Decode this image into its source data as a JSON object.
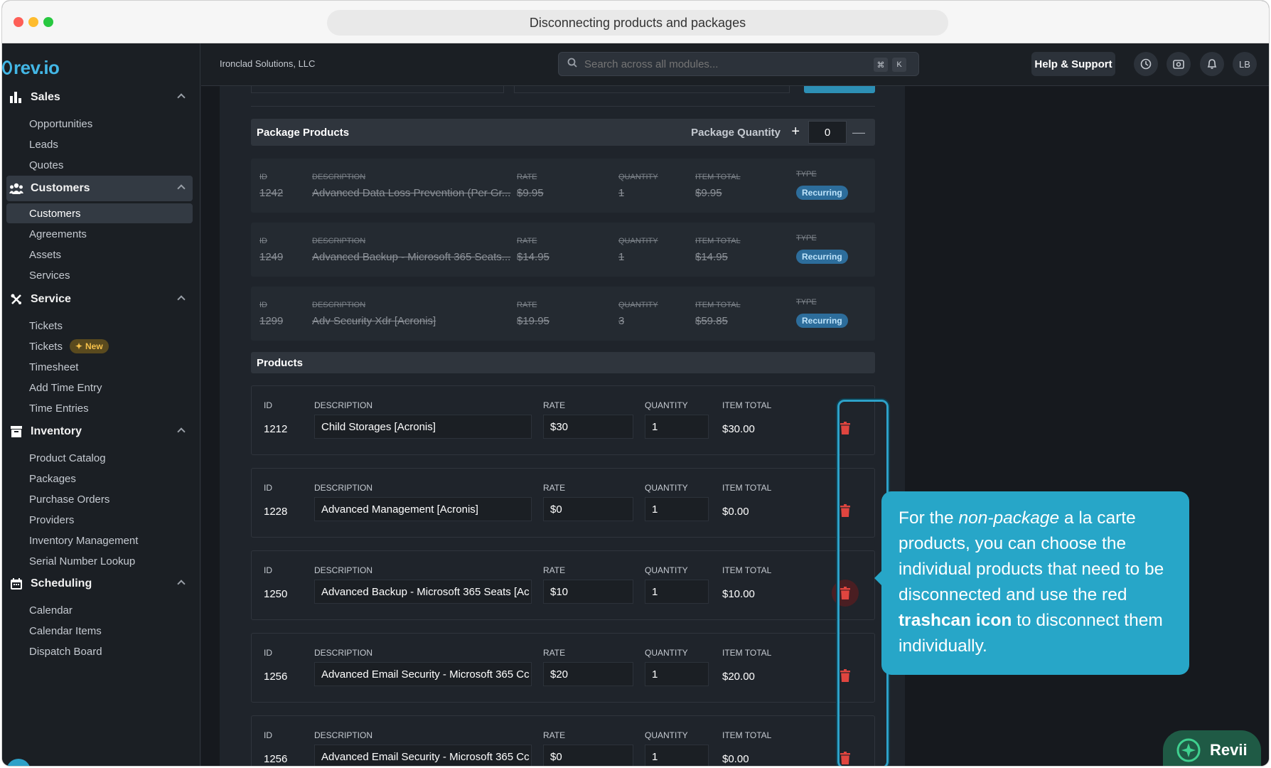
{
  "window": {
    "title": "Disconnecting products and packages"
  },
  "app": {
    "logo": "rev.io",
    "company": "Ironclad Solutions, LLC"
  },
  "search": {
    "placeholder": "Search across all modules...",
    "kbd1": "⌘",
    "kbd2": "K"
  },
  "header": {
    "help": "Help & Support",
    "avatar": "LB"
  },
  "sidebar": {
    "sections": [
      {
        "label": "Sales",
        "icon": "bar-chart-icon",
        "items": [
          "Opportunities",
          "Leads",
          "Quotes"
        ]
      },
      {
        "label": "Customers",
        "icon": "users-icon",
        "items": [
          "Customers",
          "Agreements",
          "Assets",
          "Services"
        ]
      },
      {
        "label": "Service",
        "icon": "tools-icon",
        "items": [
          "Tickets",
          "Tickets",
          "Timesheet",
          "Add Time Entry",
          "Time Entries"
        ]
      },
      {
        "label": "Inventory",
        "icon": "box-icon",
        "items": [
          "Product Catalog",
          "Packages",
          "Purchase Orders",
          "Providers",
          "Inventory Management",
          "Serial Number Lookup"
        ]
      },
      {
        "label": "Scheduling",
        "icon": "calendar-icon",
        "items": [
          "Calendar",
          "Calendar Items",
          "Dispatch Board"
        ]
      }
    ],
    "new_badge": "New"
  },
  "package_products": {
    "title": "Package Products",
    "quantity_label": "Package Quantity",
    "quantity": "0",
    "columns": [
      "ID",
      "DESCRIPTION",
      "RATE",
      "QUANTITY",
      "ITEM TOTAL",
      "TYPE"
    ],
    "rows": [
      {
        "id": "1242",
        "description": "Advanced Data Loss Prevention (Per Gr...",
        "rate": "$9.95",
        "quantity": "1",
        "total": "$9.95",
        "type": "Recurring"
      },
      {
        "id": "1249",
        "description": "Advanced Backup - Microsoft 365 Seats...",
        "rate": "$14.95",
        "quantity": "1",
        "total": "$14.95",
        "type": "Recurring"
      },
      {
        "id": "1299",
        "description": "Adv Security Xdr [Acronis]",
        "rate": "$19.95",
        "quantity": "3",
        "total": "$59.85",
        "type": "Recurring"
      }
    ]
  },
  "products": {
    "title": "Products",
    "columns": [
      "ID",
      "DESCRIPTION",
      "RATE",
      "QUANTITY",
      "ITEM TOTAL"
    ],
    "rows": [
      {
        "id": "1212",
        "description": "Child Storages [Acronis]",
        "rate": "$30",
        "quantity": "1",
        "total": "$30.00"
      },
      {
        "id": "1228",
        "description": "Advanced Management [Acronis]",
        "rate": "$0",
        "quantity": "1",
        "total": "$0.00"
      },
      {
        "id": "1250",
        "description": "Advanced Backup - Microsoft 365 Seats [Ac",
        "rate": "$10",
        "quantity": "1",
        "total": "$10.00"
      },
      {
        "id": "1256",
        "description": "Advanced Email Security - Microsoft 365 Cc",
        "rate": "$20",
        "quantity": "1",
        "total": "$20.00"
      },
      {
        "id": "1256",
        "description": "Advanced Email Security - Microsoft 365 Cc",
        "rate": "$0",
        "quantity": "1",
        "total": "$0.00"
      }
    ]
  },
  "tooltip": {
    "t1": "For the ",
    "t2": "non-package",
    "t3": " a la carte products, you can choose the individual products that need to be disconnected and use the red ",
    "t4": "trashcan icon",
    "t5": " to disconnect them individually."
  },
  "assistant": {
    "label": "Revii"
  },
  "colors": {
    "accent": "#27a6c8",
    "trash": "#e0453f",
    "recurring": "#2d6d9b"
  }
}
